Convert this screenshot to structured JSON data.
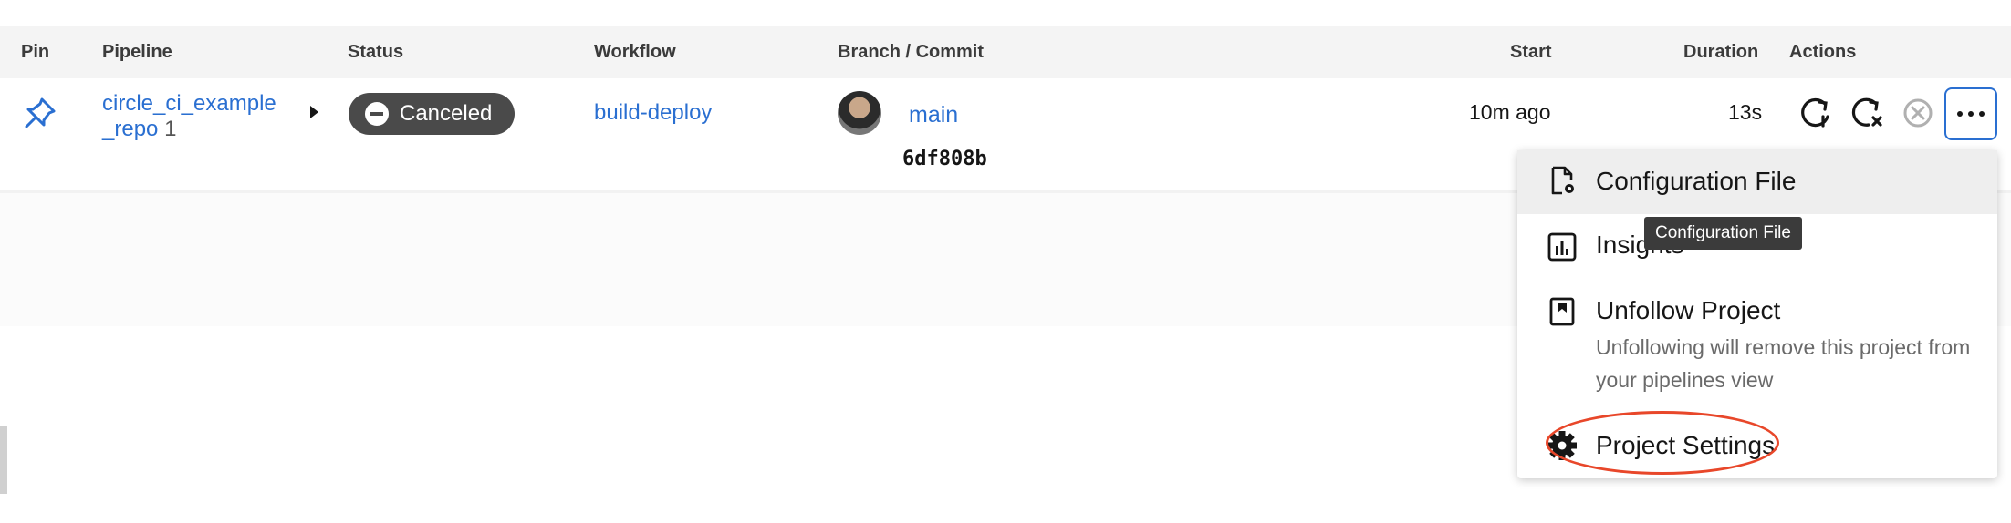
{
  "table": {
    "headers": {
      "pin": "Pin",
      "pipeline": "Pipeline",
      "status": "Status",
      "workflow": "Workflow",
      "branch_commit": "Branch / Commit",
      "start": "Start",
      "duration": "Duration",
      "actions": "Actions"
    },
    "row": {
      "pipeline_name": "circle_ci_example_repo",
      "pipeline_number": "1",
      "status": "Canceled",
      "workflow": "build-deploy",
      "branch": "main",
      "commit": "6df808b",
      "start": "10m ago",
      "duration": "13s"
    }
  },
  "menu": {
    "items": [
      {
        "label": "Configuration File",
        "icon": "config-file-icon"
      },
      {
        "label": "Insights",
        "icon": "insights-icon"
      },
      {
        "label": "Unfollow Project",
        "icon": "bookmark-icon",
        "description": "Unfollowing will remove this project from your pipelines view"
      },
      {
        "label": "Project Settings",
        "icon": "gear-icon"
      }
    ]
  },
  "tooltip": "Configuration File",
  "colors": {
    "link": "#2a6fd1",
    "status_canceled": "#4a4a4a",
    "annotation": "#e8472a",
    "header_bg": "#f4f4f4"
  }
}
